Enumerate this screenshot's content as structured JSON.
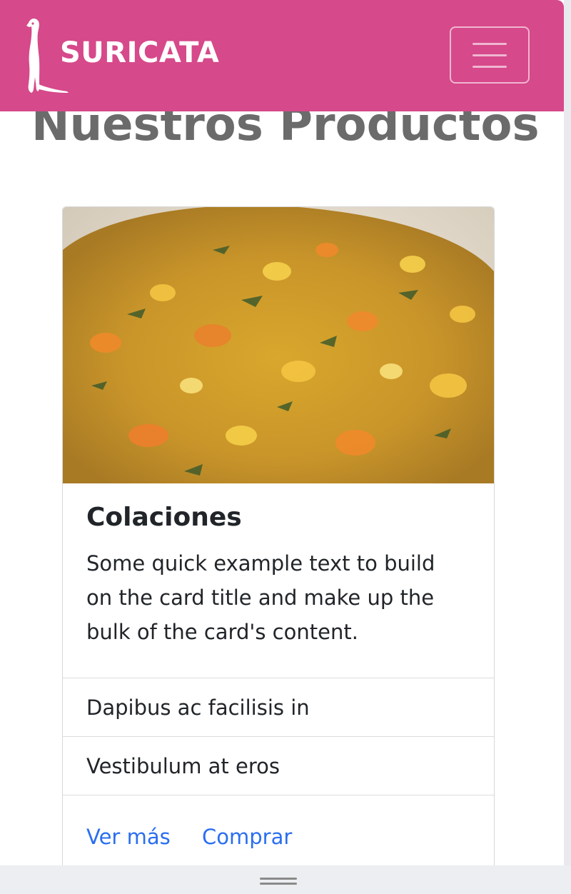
{
  "navbar": {
    "brand": "SURICATA",
    "color": "#d6498a",
    "logo_icon": "meerkat-icon",
    "toggler_icon": "hamburger-menu-icon"
  },
  "main": {
    "title": "Nuestros Productos"
  },
  "card": {
    "image_description": "food-photo",
    "title": "Colaciones",
    "text": "Some quick example text to build on the card title and make up the bulk of the card's content.",
    "list_items": [
      "Dapibus ac facilisis in",
      "Vestibulum at eros"
    ],
    "links": {
      "ver_mas": "Ver más",
      "comprar": "Comprar"
    },
    "link_color": "#2a6ef0"
  }
}
